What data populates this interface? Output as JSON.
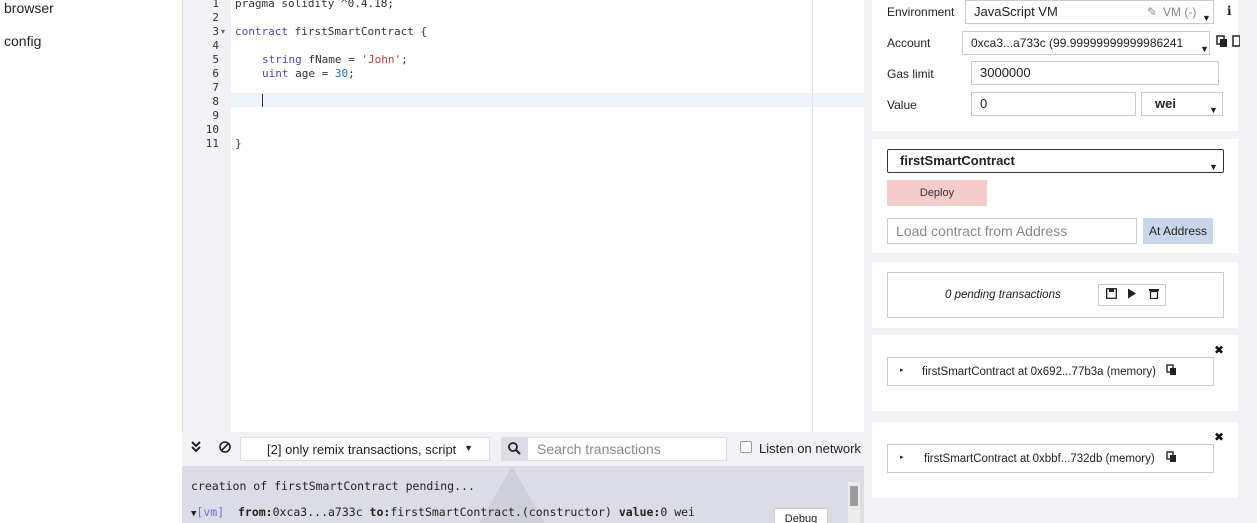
{
  "file_panel": {
    "items": [
      "browser",
      "config"
    ]
  },
  "editor": {
    "line_numbers": [
      "1",
      "2",
      "3",
      "4",
      "5",
      "6",
      "7",
      "8",
      "9",
      "10",
      "11"
    ],
    "fold_arrow": "▾",
    "lines": {
      "l1": "pragma solidity ^0.4.18;",
      "l3_kw": "contract",
      "l3_rest": " firstSmartContract {",
      "l5_kw": "string",
      "l5_mid": " fName = ",
      "l5_str": "'John'",
      "l5_end": ";",
      "l6_kw": "uint",
      "l6_mid": " age = ",
      "l6_num": "30",
      "l6_end": ";",
      "l11": "}"
    }
  },
  "terminal": {
    "collapse_icon": "double-chevron-down-icon",
    "clear_icon": "clear-icon",
    "filter_label": "[2] only remix transactions, script",
    "search_placeholder": "Search transactions",
    "listen_label": "Listen on network",
    "log_line1": "creation of firstSmartContract pending...",
    "log_vm_tag": "[vm]",
    "log_from_label": "from:",
    "log_from_value": "0xca3...a733c ",
    "log_to_label": "to:",
    "log_to_value": "firstSmartContract.(constructor) ",
    "log_value_label": "value:",
    "log_value_value": "0 wei",
    "debug_label": "Debug"
  },
  "run_panel": {
    "environment_label": "Environment",
    "environment_value": "JavaScript VM",
    "environment_vm": "VM (-)",
    "account_label": "Account",
    "account_value": "0xca3...a733c (99.99999999999986241",
    "gas_limit_label": "Gas limit",
    "gas_limit_value": "3000000",
    "value_label": "Value",
    "value_value": "0",
    "value_unit": "wei",
    "contract_selected": "firstSmartContract",
    "deploy_label": "Deploy",
    "load_placeholder": "Load contract from Address",
    "at_address_label": "At Address",
    "pending_text": "0 pending transactions",
    "instances": [
      "firstSmartContract at 0x692...77b3a (memory)",
      "firstSmartContract at 0xbbf...732db (memory)"
    ]
  },
  "colors": {
    "deploy_bg": "#f4cccc",
    "at_address_bg": "#c9d5e8",
    "panel_bg": "#f1f1f6",
    "vm_tag": "#6b73d9"
  }
}
